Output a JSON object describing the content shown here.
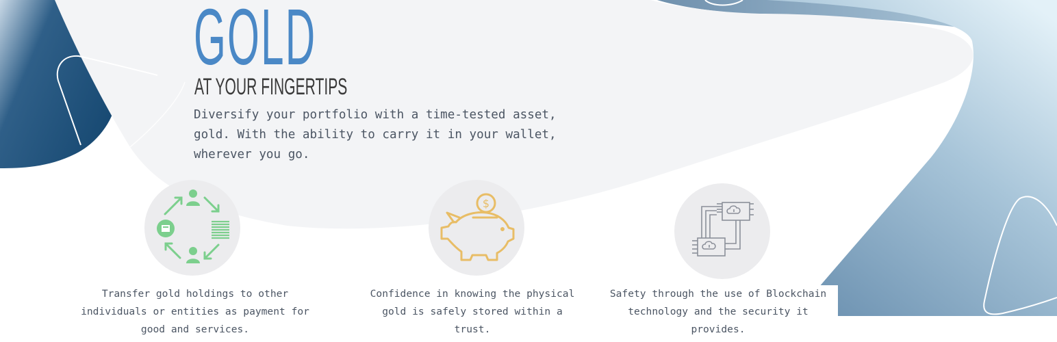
{
  "hero": {
    "headline": "GOLD",
    "subheadline": "AT YOUR FINGERTIPS",
    "intro": "Diversify your portfolio with a time-tested asset, gold. With the ability to carry it in your wallet, wherever you go."
  },
  "features": [
    {
      "icon": "transfer-cycle-icon",
      "text": "Transfer gold holdings to other individuals or entities as payment for good and services."
    },
    {
      "icon": "piggy-bank-icon",
      "text": "Confidence in knowing the physical gold is safely stored within a trust."
    },
    {
      "icon": "blockchain-servers-icon",
      "text": "Safety through the use of Blockchain technology and the security it provides."
    }
  ],
  "colors": {
    "headline": "#4a88c6",
    "transfer_icon": "#7ccf8d",
    "piggy_icon": "#e8bd66",
    "server_icon": "#8b8f99"
  }
}
